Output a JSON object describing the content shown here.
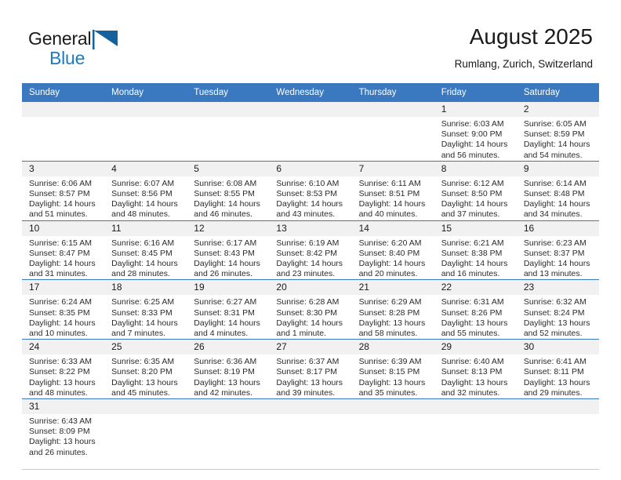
{
  "brand": {
    "line1": "General",
    "line2": "Blue",
    "flag_icon": "blue-triangle-flag-icon",
    "accent_color": "#2179c0"
  },
  "header": {
    "title": "August 2025",
    "subtitle": "Rumlang, Zurich, Switzerland"
  },
  "calendar": {
    "header_bg": "#3a79bf",
    "daynum_bg": "#f1f1f1",
    "weekdays": [
      "Sunday",
      "Monday",
      "Tuesday",
      "Wednesday",
      "Thursday",
      "Friday",
      "Saturday"
    ],
    "labels": {
      "sunrise": "Sunrise:",
      "sunset": "Sunset:",
      "daylight": "Daylight:"
    },
    "weeks": [
      [
        {
          "day": "",
          "sunrise": "",
          "sunset": "",
          "daylight": ""
        },
        {
          "day": "",
          "sunrise": "",
          "sunset": "",
          "daylight": ""
        },
        {
          "day": "",
          "sunrise": "",
          "sunset": "",
          "daylight": ""
        },
        {
          "day": "",
          "sunrise": "",
          "sunset": "",
          "daylight": ""
        },
        {
          "day": "",
          "sunrise": "",
          "sunset": "",
          "daylight": ""
        },
        {
          "day": "1",
          "sunrise": "Sunrise: 6:03 AM",
          "sunset": "Sunset: 9:00 PM",
          "daylight": "Daylight: 14 hours and 56 minutes."
        },
        {
          "day": "2",
          "sunrise": "Sunrise: 6:05 AM",
          "sunset": "Sunset: 8:59 PM",
          "daylight": "Daylight: 14 hours and 54 minutes."
        }
      ],
      [
        {
          "day": "3",
          "sunrise": "Sunrise: 6:06 AM",
          "sunset": "Sunset: 8:57 PM",
          "daylight": "Daylight: 14 hours and 51 minutes."
        },
        {
          "day": "4",
          "sunrise": "Sunrise: 6:07 AM",
          "sunset": "Sunset: 8:56 PM",
          "daylight": "Daylight: 14 hours and 48 minutes."
        },
        {
          "day": "5",
          "sunrise": "Sunrise: 6:08 AM",
          "sunset": "Sunset: 8:55 PM",
          "daylight": "Daylight: 14 hours and 46 minutes."
        },
        {
          "day": "6",
          "sunrise": "Sunrise: 6:10 AM",
          "sunset": "Sunset: 8:53 PM",
          "daylight": "Daylight: 14 hours and 43 minutes."
        },
        {
          "day": "7",
          "sunrise": "Sunrise: 6:11 AM",
          "sunset": "Sunset: 8:51 PM",
          "daylight": "Daylight: 14 hours and 40 minutes."
        },
        {
          "day": "8",
          "sunrise": "Sunrise: 6:12 AM",
          "sunset": "Sunset: 8:50 PM",
          "daylight": "Daylight: 14 hours and 37 minutes."
        },
        {
          "day": "9",
          "sunrise": "Sunrise: 6:14 AM",
          "sunset": "Sunset: 8:48 PM",
          "daylight": "Daylight: 14 hours and 34 minutes."
        }
      ],
      [
        {
          "day": "10",
          "sunrise": "Sunrise: 6:15 AM",
          "sunset": "Sunset: 8:47 PM",
          "daylight": "Daylight: 14 hours and 31 minutes."
        },
        {
          "day": "11",
          "sunrise": "Sunrise: 6:16 AM",
          "sunset": "Sunset: 8:45 PM",
          "daylight": "Daylight: 14 hours and 28 minutes."
        },
        {
          "day": "12",
          "sunrise": "Sunrise: 6:17 AM",
          "sunset": "Sunset: 8:43 PM",
          "daylight": "Daylight: 14 hours and 26 minutes."
        },
        {
          "day": "13",
          "sunrise": "Sunrise: 6:19 AM",
          "sunset": "Sunset: 8:42 PM",
          "daylight": "Daylight: 14 hours and 23 minutes."
        },
        {
          "day": "14",
          "sunrise": "Sunrise: 6:20 AM",
          "sunset": "Sunset: 8:40 PM",
          "daylight": "Daylight: 14 hours and 20 minutes."
        },
        {
          "day": "15",
          "sunrise": "Sunrise: 6:21 AM",
          "sunset": "Sunset: 8:38 PM",
          "daylight": "Daylight: 14 hours and 16 minutes."
        },
        {
          "day": "16",
          "sunrise": "Sunrise: 6:23 AM",
          "sunset": "Sunset: 8:37 PM",
          "daylight": "Daylight: 14 hours and 13 minutes."
        }
      ],
      [
        {
          "day": "17",
          "sunrise": "Sunrise: 6:24 AM",
          "sunset": "Sunset: 8:35 PM",
          "daylight": "Daylight: 14 hours and 10 minutes."
        },
        {
          "day": "18",
          "sunrise": "Sunrise: 6:25 AM",
          "sunset": "Sunset: 8:33 PM",
          "daylight": "Daylight: 14 hours and 7 minutes."
        },
        {
          "day": "19",
          "sunrise": "Sunrise: 6:27 AM",
          "sunset": "Sunset: 8:31 PM",
          "daylight": "Daylight: 14 hours and 4 minutes."
        },
        {
          "day": "20",
          "sunrise": "Sunrise: 6:28 AM",
          "sunset": "Sunset: 8:30 PM",
          "daylight": "Daylight: 14 hours and 1 minute."
        },
        {
          "day": "21",
          "sunrise": "Sunrise: 6:29 AM",
          "sunset": "Sunset: 8:28 PM",
          "daylight": "Daylight: 13 hours and 58 minutes."
        },
        {
          "day": "22",
          "sunrise": "Sunrise: 6:31 AM",
          "sunset": "Sunset: 8:26 PM",
          "daylight": "Daylight: 13 hours and 55 minutes."
        },
        {
          "day": "23",
          "sunrise": "Sunrise: 6:32 AM",
          "sunset": "Sunset: 8:24 PM",
          "daylight": "Daylight: 13 hours and 52 minutes."
        }
      ],
      [
        {
          "day": "24",
          "sunrise": "Sunrise: 6:33 AM",
          "sunset": "Sunset: 8:22 PM",
          "daylight": "Daylight: 13 hours and 48 minutes."
        },
        {
          "day": "25",
          "sunrise": "Sunrise: 6:35 AM",
          "sunset": "Sunset: 8:20 PM",
          "daylight": "Daylight: 13 hours and 45 minutes."
        },
        {
          "day": "26",
          "sunrise": "Sunrise: 6:36 AM",
          "sunset": "Sunset: 8:19 PM",
          "daylight": "Daylight: 13 hours and 42 minutes."
        },
        {
          "day": "27",
          "sunrise": "Sunrise: 6:37 AM",
          "sunset": "Sunset: 8:17 PM",
          "daylight": "Daylight: 13 hours and 39 minutes."
        },
        {
          "day": "28",
          "sunrise": "Sunrise: 6:39 AM",
          "sunset": "Sunset: 8:15 PM",
          "daylight": "Daylight: 13 hours and 35 minutes."
        },
        {
          "day": "29",
          "sunrise": "Sunrise: 6:40 AM",
          "sunset": "Sunset: 8:13 PM",
          "daylight": "Daylight: 13 hours and 32 minutes."
        },
        {
          "day": "30",
          "sunrise": "Sunrise: 6:41 AM",
          "sunset": "Sunset: 8:11 PM",
          "daylight": "Daylight: 13 hours and 29 minutes."
        }
      ],
      [
        {
          "day": "31",
          "sunrise": "Sunrise: 6:43 AM",
          "sunset": "Sunset: 8:09 PM",
          "daylight": "Daylight: 13 hours and 26 minutes."
        },
        {
          "day": "",
          "sunrise": "",
          "sunset": "",
          "daylight": ""
        },
        {
          "day": "",
          "sunrise": "",
          "sunset": "",
          "daylight": ""
        },
        {
          "day": "",
          "sunrise": "",
          "sunset": "",
          "daylight": ""
        },
        {
          "day": "",
          "sunrise": "",
          "sunset": "",
          "daylight": ""
        },
        {
          "day": "",
          "sunrise": "",
          "sunset": "",
          "daylight": ""
        },
        {
          "day": "",
          "sunrise": "",
          "sunset": "",
          "daylight": ""
        }
      ]
    ]
  }
}
